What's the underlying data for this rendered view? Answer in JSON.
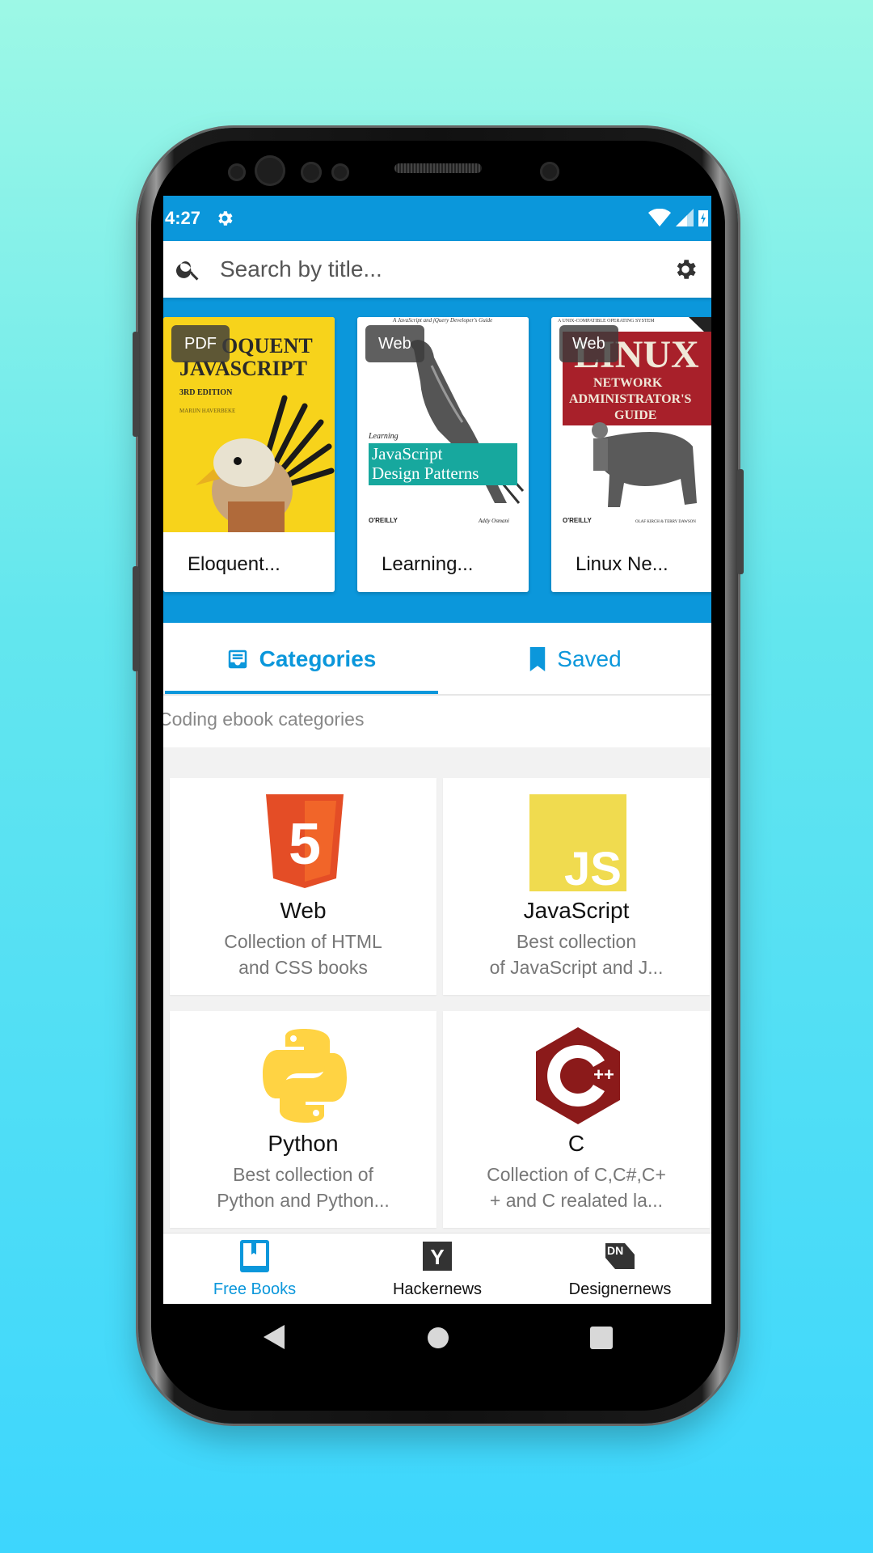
{
  "status_bar": {
    "time": "4:27"
  },
  "search": {
    "placeholder": "Search by title..."
  },
  "featured": [
    {
      "badge": "PDF",
      "title": "Eloquent..."
    },
    {
      "badge": "Web",
      "title": "Learning..."
    },
    {
      "badge": "Web",
      "title": "Linux Ne..."
    }
  ],
  "covers": {
    "eloquent": {
      "line1": "OQUENT",
      "line2": "JAVASCRIPT",
      "edition": "3RD EDITION",
      "author": "MARIJN HAVERBEKE"
    },
    "learning": {
      "tagline": "A JavaScript and jQuery Developer's Guide",
      "learning": "Learning",
      "line1": "JavaScript",
      "line2": "Design Patterns",
      "publisher": "O'REILLY",
      "author": "Addy Osmani"
    },
    "linux": {
      "tagline": "A UNIX-COMPATIBLE OPERATING SYSTEM",
      "line1": "LINUX",
      "line2": "NETWORK",
      "line3": "ADMINISTRATOR'S",
      "line4": "GUIDE",
      "publisher": "O'REILLY",
      "authors": "OLAF KIRCH & TERRY DAWSON"
    }
  },
  "tabs": [
    {
      "label": "Categories",
      "icon": "inbox-icon",
      "active": true
    },
    {
      "label": "Saved",
      "icon": "bookmark-icon",
      "active": false
    }
  ],
  "section_label": "Coding ebook categories",
  "categories": [
    {
      "name": "Web",
      "desc1": "Collection of HTML",
      "desc2": "and CSS books",
      "icon": "html5-icon",
      "logo_text": "5"
    },
    {
      "name": "JavaScript",
      "desc1": "Best collection",
      "desc2": "of JavaScript and J...",
      "icon": "js-icon",
      "logo_text": "JS"
    },
    {
      "name": "Python",
      "desc1": "Best collection of",
      "desc2": "Python and Python...",
      "icon": "python-icon"
    },
    {
      "name": "C",
      "desc1": "Collection of C,C#,C+",
      "desc2": "+ and C realated la...",
      "icon": "cplusplus-icon",
      "logo_text": "++"
    }
  ],
  "bottom_nav": [
    {
      "label": "Free Books",
      "icon": "book-icon",
      "active": true,
      "icon_text": ""
    },
    {
      "label": "Hackernews",
      "icon": "y-combinator-icon",
      "active": false,
      "icon_text": "Y"
    },
    {
      "label": "Designernews",
      "icon": "dn-icon",
      "active": false,
      "icon_text": "DN"
    }
  ],
  "colors": {
    "primary": "#0b97db",
    "html5": "#e44d26",
    "js": "#f0db4f",
    "python": "#ffd343",
    "cpp": "#8b1a1a"
  }
}
